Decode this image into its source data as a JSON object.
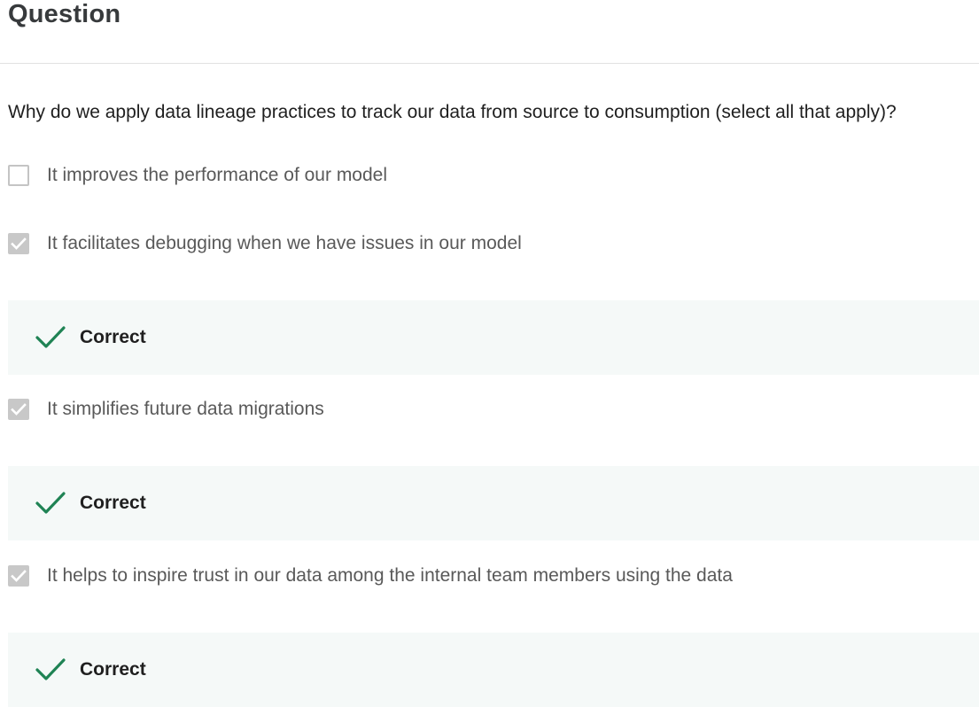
{
  "question": {
    "heading": "Question",
    "prompt": "Why do we apply data lineage practices to track our data from source to consumption (select all that apply)?"
  },
  "options": [
    {
      "label": "It improves the performance of our model",
      "checked": false
    },
    {
      "label": "It facilitates debugging when we have issues in our model",
      "checked": true,
      "feedback": "Correct"
    },
    {
      "label": "It simplifies future data migrations",
      "checked": true,
      "feedback": "Correct"
    },
    {
      "label": "It helps to inspire trust in our data among the internal team members using the data",
      "checked": true,
      "feedback": "Correct"
    }
  ],
  "colors": {
    "correct_check": "#1f8354",
    "feedback_bg": "#f5f9f8",
    "checkbox_checked_bg": "#c8c8c8"
  },
  "icons": {
    "feedback": "checkmark-icon",
    "checkbox_checked": "checkbox-checked-icon",
    "checkbox_unchecked": "checkbox-empty-icon"
  }
}
